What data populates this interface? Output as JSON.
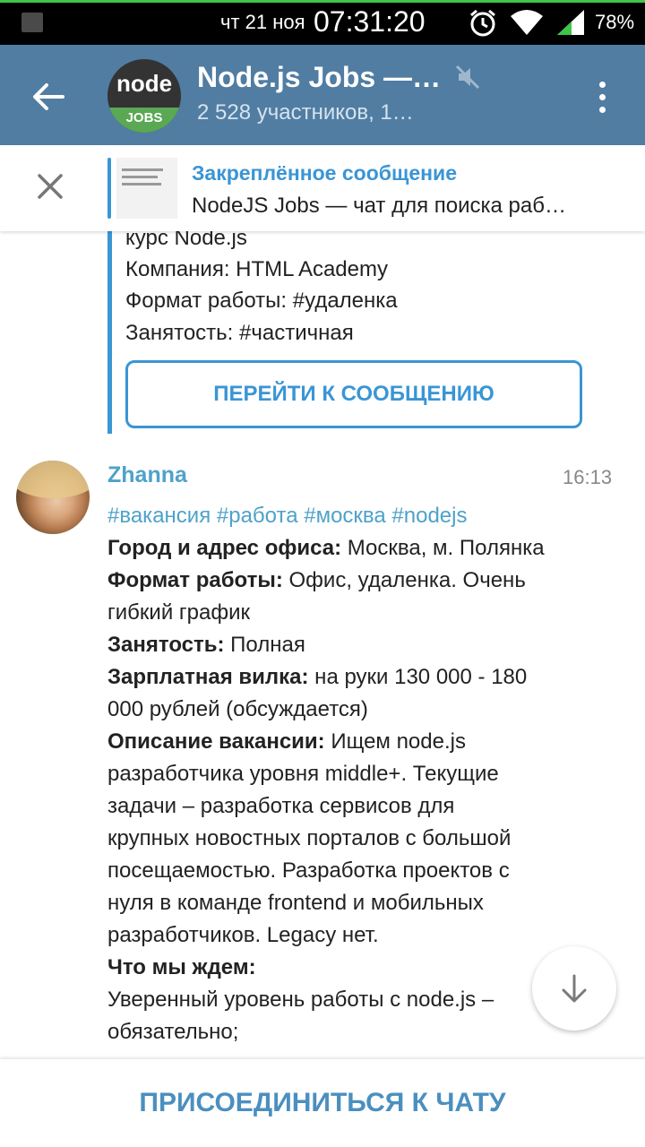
{
  "status_bar": {
    "date": "чт 21 ноя",
    "time": "07:31:20",
    "battery": "78%",
    "icons": [
      "notification-icon",
      "alarm-icon",
      "wifi-icon",
      "signal-icon"
    ]
  },
  "header": {
    "title": "Node.js Jobs —…",
    "subtitle": "2 528 участников, 1…",
    "avatar_text_top": "node",
    "avatar_text_bottom": "JOBS",
    "colors": {
      "bar": "#517da2",
      "accent": "#3a95d5"
    }
  },
  "pinned": {
    "title": "Закреплённое сообщение",
    "text": "NodeJS Jobs — чат для поиска раб…"
  },
  "previous_message": {
    "lines": [
      "курс Node.js",
      "Компания: HTML Academy",
      "Формат работы: #удаленка",
      "Занятость: #частичная"
    ],
    "goto_button": "ПЕРЕЙТИ К СООБЩЕНИЮ"
  },
  "message": {
    "sender": "Zhanna",
    "time": "16:13",
    "tags": "#вакансия #работа #москва #nodejs",
    "lines": [
      {
        "bold": "Город и адрес офиса:",
        "text": " Москва, м. Полянка"
      },
      {
        "bold": "Формат работы:",
        "text": " Офис, удаленка. Очень"
      },
      {
        "bold": "",
        "text": "гибкий график"
      },
      {
        "bold": "Занятость:",
        "text": " Полная"
      },
      {
        "bold": "Зарплатная вилка:",
        "text": " на руки 130 000 - 180"
      },
      {
        "bold": "",
        "text": "000 рублей (обсуждается)"
      },
      {
        "bold": "Описание вакансии:",
        "text": " Ищем node.js"
      },
      {
        "bold": "",
        "text": "разработчика уровня middle+. Текущие"
      },
      {
        "bold": "",
        "text": "задачи – разработка сервисов для"
      },
      {
        "bold": "",
        "text": "крупных новостных порталов с большой"
      },
      {
        "bold": "",
        "text": "посещаемостью. Разработка проектов с"
      },
      {
        "bold": "",
        "text": "нуля в команде frontend и мобильных"
      },
      {
        "bold": "",
        "text": "разработчиков. Legacy нет."
      },
      {
        "bold": "Что мы ждем:",
        "text": ""
      },
      {
        "bold": "",
        "text": "Уверенный уровень работы с node.js –"
      },
      {
        "bold": "",
        "text": "обязательно;"
      }
    ]
  },
  "join_button": "ПРИСОЕДИНИТЬСЯ К ЧАТУ"
}
